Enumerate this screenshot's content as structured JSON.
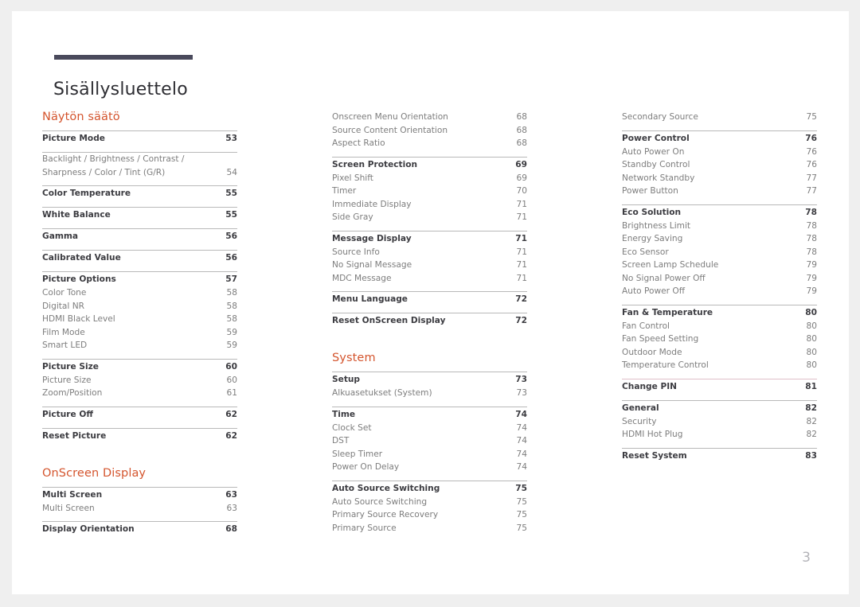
{
  "document": {
    "title": "Sisällysluettelo",
    "page_number": "3",
    "accent_color": "#d4552e",
    "rule_color": "#4a4a5c"
  },
  "columns": [
    {
      "name": "column-1",
      "sections": [
        {
          "heading": "Näytön säätö",
          "groups": [
            {
              "rule": "normal",
              "entries": [
                {
                  "label": "Picture Mode",
                  "page": "53",
                  "level": 1,
                  "wrap": false
                }
              ]
            },
            {
              "rule": "normal",
              "entries": [
                {
                  "label": "Backlight / Brightness / Contrast / Sharpness / Color / Tint (G/R)",
                  "page": "54",
                  "level": 2,
                  "wrap": true
                }
              ]
            },
            {
              "rule": "normal",
              "entries": [
                {
                  "label": "Color Temperature",
                  "page": "55",
                  "level": 1,
                  "wrap": false
                }
              ]
            },
            {
              "rule": "normal",
              "entries": [
                {
                  "label": "White Balance",
                  "page": "55",
                  "level": 1,
                  "wrap": false
                }
              ]
            },
            {
              "rule": "normal",
              "entries": [
                {
                  "label": "Gamma",
                  "page": "56",
                  "level": 1,
                  "wrap": false
                }
              ]
            },
            {
              "rule": "normal",
              "entries": [
                {
                  "label": "Calibrated Value",
                  "page": "56",
                  "level": 1,
                  "wrap": false
                }
              ]
            },
            {
              "rule": "normal",
              "entries": [
                {
                  "label": "Picture Options",
                  "page": "57",
                  "level": 1,
                  "wrap": false
                },
                {
                  "label": "Color Tone",
                  "page": "58",
                  "level": 2,
                  "wrap": false
                },
                {
                  "label": "Digital NR",
                  "page": "58",
                  "level": 2,
                  "wrap": false
                },
                {
                  "label": "HDMI Black Level",
                  "page": "58",
                  "level": 2,
                  "wrap": false
                },
                {
                  "label": "Film Mode",
                  "page": "59",
                  "level": 2,
                  "wrap": false
                },
                {
                  "label": "Smart LED",
                  "page": "59",
                  "level": 2,
                  "wrap": false
                }
              ]
            },
            {
              "rule": "normal",
              "entries": [
                {
                  "label": "Picture Size",
                  "page": "60",
                  "level": 1,
                  "wrap": false
                },
                {
                  "label": "Picture Size",
                  "page": "60",
                  "level": 2,
                  "wrap": false
                },
                {
                  "label": "Zoom/Position",
                  "page": "61",
                  "level": 2,
                  "wrap": false
                }
              ]
            },
            {
              "rule": "normal",
              "entries": [
                {
                  "label": "Picture Off",
                  "page": "62",
                  "level": 1,
                  "wrap": false
                }
              ]
            },
            {
              "rule": "normal",
              "entries": [
                {
                  "label": "Reset Picture",
                  "page": "62",
                  "level": 1,
                  "wrap": false
                }
              ]
            }
          ]
        },
        {
          "heading": "OnScreen Display",
          "groups": [
            {
              "rule": "normal",
              "entries": [
                {
                  "label": "Multi Screen",
                  "page": "63",
                  "level": 1,
                  "wrap": false
                },
                {
                  "label": "Multi Screen",
                  "page": "63",
                  "level": 2,
                  "wrap": false
                }
              ]
            },
            {
              "rule": "normal",
              "entries": [
                {
                  "label": "Display Orientation",
                  "page": "68",
                  "level": 1,
                  "wrap": false
                }
              ]
            }
          ]
        }
      ]
    },
    {
      "name": "column-2",
      "sections": [
        {
          "heading": "",
          "groups": [
            {
              "rule": "none",
              "entries": [
                {
                  "label": "Onscreen Menu Orientation",
                  "page": "68",
                  "level": 2,
                  "wrap": false
                },
                {
                  "label": "Source Content Orientation",
                  "page": "68",
                  "level": 2,
                  "wrap": false
                },
                {
                  "label": "Aspect Ratio",
                  "page": "68",
                  "level": 2,
                  "wrap": false
                }
              ]
            },
            {
              "rule": "normal",
              "entries": [
                {
                  "label": "Screen Protection",
                  "page": "69",
                  "level": 1,
                  "wrap": false
                },
                {
                  "label": "Pixel Shift",
                  "page": "69",
                  "level": 2,
                  "wrap": false
                },
                {
                  "label": "Timer",
                  "page": "70",
                  "level": 2,
                  "wrap": false
                },
                {
                  "label": "Immediate Display",
                  "page": "71",
                  "level": 2,
                  "wrap": false
                },
                {
                  "label": "Side Gray",
                  "page": "71",
                  "level": 2,
                  "wrap": false
                }
              ]
            },
            {
              "rule": "normal",
              "entries": [
                {
                  "label": "Message Display",
                  "page": "71",
                  "level": 1,
                  "wrap": false
                },
                {
                  "label": "Source Info",
                  "page": "71",
                  "level": 2,
                  "wrap": false
                },
                {
                  "label": "No Signal Message",
                  "page": "71",
                  "level": 2,
                  "wrap": false
                },
                {
                  "label": "MDC Message",
                  "page": "71",
                  "level": 2,
                  "wrap": false
                }
              ]
            },
            {
              "rule": "normal",
              "entries": [
                {
                  "label": "Menu Language",
                  "page": "72",
                  "level": 1,
                  "wrap": false
                }
              ]
            },
            {
              "rule": "normal",
              "entries": [
                {
                  "label": "Reset OnScreen Display",
                  "page": "72",
                  "level": 1,
                  "wrap": false
                }
              ]
            }
          ]
        },
        {
          "heading": "System",
          "groups": [
            {
              "rule": "normal",
              "entries": [
                {
                  "label": "Setup",
                  "page": "73",
                  "level": 1,
                  "wrap": false
                },
                {
                  "label": "Alkuasetukset (System)",
                  "page": "73",
                  "level": 2,
                  "wrap": false
                }
              ]
            },
            {
              "rule": "normal",
              "entries": [
                {
                  "label": "Time",
                  "page": "74",
                  "level": 1,
                  "wrap": false
                },
                {
                  "label": "Clock Set",
                  "page": "74",
                  "level": 2,
                  "wrap": false
                },
                {
                  "label": "DST",
                  "page": "74",
                  "level": 2,
                  "wrap": false
                },
                {
                  "label": "Sleep Timer",
                  "page": "74",
                  "level": 2,
                  "wrap": false
                },
                {
                  "label": "Power On Delay",
                  "page": "74",
                  "level": 2,
                  "wrap": false
                }
              ]
            },
            {
              "rule": "normal",
              "entries": [
                {
                  "label": "Auto Source Switching",
                  "page": "75",
                  "level": 1,
                  "wrap": false
                },
                {
                  "label": "Auto Source Switching",
                  "page": "75",
                  "level": 2,
                  "wrap": false
                },
                {
                  "label": "Primary Source Recovery",
                  "page": "75",
                  "level": 2,
                  "wrap": false
                },
                {
                  "label": "Primary Source",
                  "page": "75",
                  "level": 2,
                  "wrap": false
                }
              ]
            }
          ]
        }
      ]
    },
    {
      "name": "column-3",
      "sections": [
        {
          "heading": "",
          "groups": [
            {
              "rule": "none",
              "entries": [
                {
                  "label": "Secondary Source",
                  "page": "75",
                  "level": 2,
                  "wrap": false
                }
              ]
            },
            {
              "rule": "normal",
              "entries": [
                {
                  "label": "Power Control",
                  "page": "76",
                  "level": 1,
                  "wrap": false
                },
                {
                  "label": "Auto Power On",
                  "page": "76",
                  "level": 2,
                  "wrap": false
                },
                {
                  "label": "Standby Control",
                  "page": "76",
                  "level": 2,
                  "wrap": false
                },
                {
                  "label": "Network Standby",
                  "page": "77",
                  "level": 2,
                  "wrap": false
                },
                {
                  "label": "Power Button",
                  "page": "77",
                  "level": 2,
                  "wrap": false
                }
              ]
            },
            {
              "rule": "normal",
              "entries": [
                {
                  "label": "Eco Solution",
                  "page": "78",
                  "level": 1,
                  "wrap": false
                },
                {
                  "label": "Brightness Limit",
                  "page": "78",
                  "level": 2,
                  "wrap": false
                },
                {
                  "label": "Energy Saving",
                  "page": "78",
                  "level": 2,
                  "wrap": false
                },
                {
                  "label": "Eco Sensor",
                  "page": "78",
                  "level": 2,
                  "wrap": false
                },
                {
                  "label": "Screen Lamp Schedule",
                  "page": "79",
                  "level": 2,
                  "wrap": false
                },
                {
                  "label": "No Signal Power Off",
                  "page": "79",
                  "level": 2,
                  "wrap": false
                },
                {
                  "label": "Auto Power Off",
                  "page": "79",
                  "level": 2,
                  "wrap": false
                }
              ]
            },
            {
              "rule": "normal",
              "entries": [
                {
                  "label": "Fan & Temperature",
                  "page": "80",
                  "level": 1,
                  "wrap": false
                },
                {
                  "label": "Fan Control",
                  "page": "80",
                  "level": 2,
                  "wrap": false
                },
                {
                  "label": "Fan Speed Setting",
                  "page": "80",
                  "level": 2,
                  "wrap": false
                },
                {
                  "label": "Outdoor Mode",
                  "page": "80",
                  "level": 2,
                  "wrap": false
                },
                {
                  "label": "Temperature Control",
                  "page": "80",
                  "level": 2,
                  "wrap": false
                }
              ]
            },
            {
              "rule": "accent",
              "entries": [
                {
                  "label": "Change PIN",
                  "page": "81",
                  "level": 1,
                  "wrap": false
                }
              ]
            },
            {
              "rule": "normal",
              "entries": [
                {
                  "label": "General",
                  "page": "82",
                  "level": 1,
                  "wrap": false
                },
                {
                  "label": "Security",
                  "page": "82",
                  "level": 2,
                  "wrap": false
                },
                {
                  "label": "HDMI Hot Plug",
                  "page": "82",
                  "level": 2,
                  "wrap": false
                }
              ]
            },
            {
              "rule": "normal",
              "entries": [
                {
                  "label": "Reset System",
                  "page": "83",
                  "level": 1,
                  "wrap": false
                }
              ]
            }
          ]
        }
      ]
    }
  ]
}
